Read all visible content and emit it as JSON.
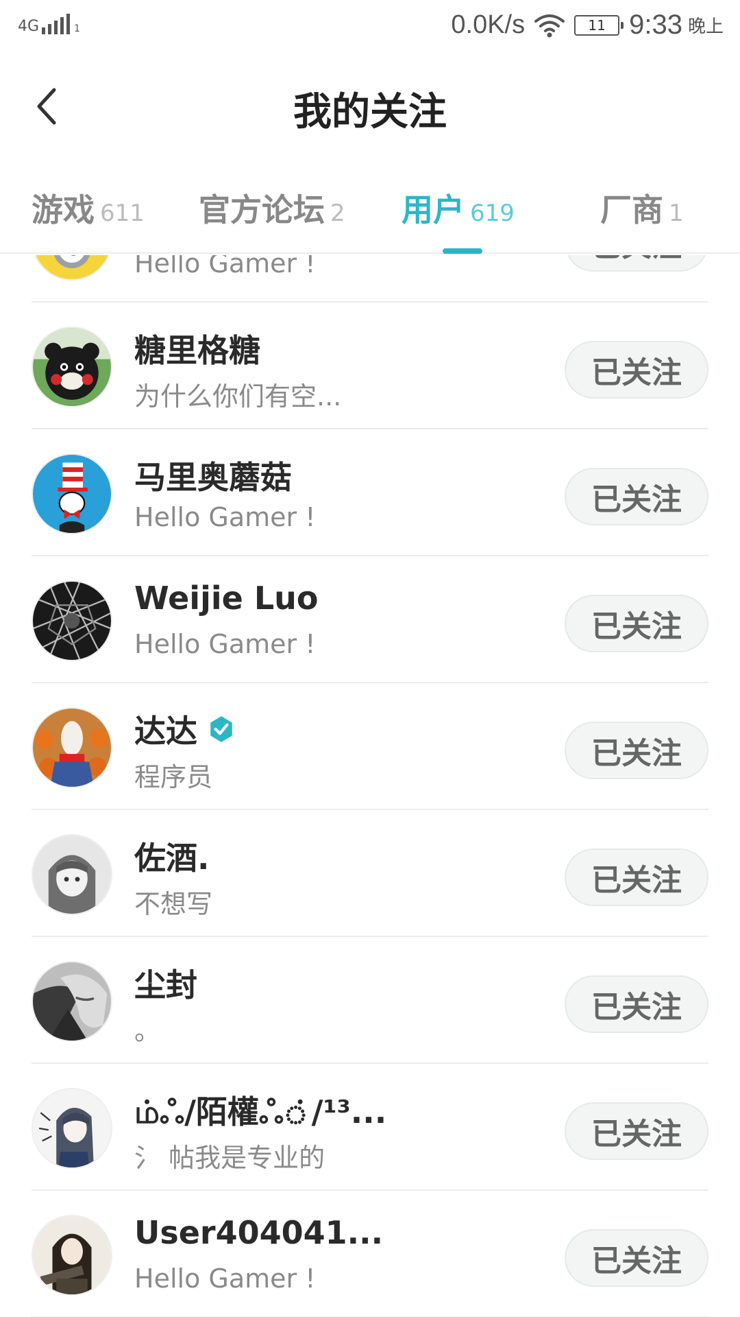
{
  "status_bar": {
    "network": "4G",
    "signal_sub": "1",
    "speed": "0.0K/s",
    "battery": "11",
    "time": "9:33",
    "time_suffix": "晚上"
  },
  "header": {
    "title": "我的关注"
  },
  "tabs": [
    {
      "label": "游戏",
      "count": "611",
      "active": false
    },
    {
      "label": "官方论坛",
      "count": "2",
      "active": false
    },
    {
      "label": "用户",
      "count": "619",
      "active": true
    },
    {
      "label": "厂商",
      "count": "1",
      "active": false
    }
  ],
  "colors": {
    "accent": "#2bb6c6",
    "verified": "#2bb6c6"
  },
  "list": {
    "follow_label": "已关注",
    "users": [
      {
        "name": "",
        "bio": "Hello Gamer !",
        "avatar": "minion-avatar"
      },
      {
        "name": "糖里格糖",
        "bio": "为什么你们有空...",
        "avatar": "bear-avatar"
      },
      {
        "name": "马里奥蘑菇",
        "bio": "Hello Gamer !",
        "avatar": "cat-in-hat-avatar"
      },
      {
        "name": "Weijie  Luo",
        "bio": "Hello Gamer !",
        "avatar": "geometric-avatar"
      },
      {
        "name": "达达",
        "bio": "程序员",
        "avatar": "horse-mask-avatar",
        "verified": true
      },
      {
        "name": "佐酒.",
        "bio": "不想写",
        "avatar": "anime-girl-avatar"
      },
      {
        "name": "尘封",
        "bio": "。",
        "avatar": "anime-boy-avatar"
      },
      {
        "name": "ம்ஃ/陌權ஃ்/¹³...",
        "bio": "氵 帖我是专业的",
        "avatar": "sketch-avatar"
      },
      {
        "name": "User404041...",
        "bio": "Hello Gamer !",
        "avatar": "soldier-avatar"
      }
    ]
  }
}
